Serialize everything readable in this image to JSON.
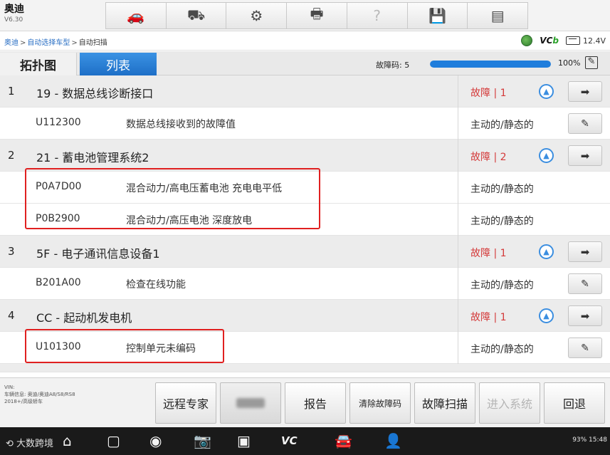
{
  "app": {
    "name": "奥迪",
    "version": "V6.30"
  },
  "toolbar": [
    {
      "icon": "car-upload-icon",
      "glyph": "🚗",
      "state": "active"
    },
    {
      "icon": "car-lift-icon",
      "glyph": "⛟",
      "state": "normal"
    },
    {
      "icon": "gear-icon",
      "glyph": "⚙",
      "state": "normal"
    },
    {
      "icon": "printer-icon",
      "glyph": "🖶",
      "state": "normal"
    },
    {
      "icon": "help-icon",
      "glyph": "?",
      "state": "disabled"
    },
    {
      "icon": "save-icon",
      "glyph": "💾",
      "state": "normal"
    },
    {
      "icon": "message-icon",
      "glyph": "▤",
      "state": "normal"
    }
  ],
  "breadcrumb": {
    "item1": "奥迪",
    "item2": "自动选择车型",
    "item3": "自动扫描",
    "sep": ">"
  },
  "status": {
    "vci": "VC",
    "vci_suffix": "b",
    "voltage": "12.4V"
  },
  "tabs": {
    "topology": "拓扑图",
    "list": "列表"
  },
  "scan": {
    "fault_count_label": "故障码: 5",
    "progress_percent": 100,
    "progress_label": "100%"
  },
  "rows": [
    {
      "type": "sys",
      "index": "1",
      "name": "19 - 数据总线诊断接口",
      "fault": "故障 | 1"
    },
    {
      "type": "dtc",
      "code": "U112300",
      "desc": "数据总线接收到的故障值",
      "state": "主动的/静态的",
      "note": true
    },
    {
      "type": "sys",
      "index": "2",
      "name": "21 - 蓄电池管理系统2",
      "fault": "故障 | 2"
    },
    {
      "type": "dtc",
      "code": "P0A7D00",
      "desc": "混合动力/高电压蓄电池  充电电平低",
      "state": "主动的/静态的",
      "note": false
    },
    {
      "type": "dtc",
      "code": "P0B2900",
      "desc": "混合动力/高压电池  深度放电",
      "state": "主动的/静态的",
      "note": false
    },
    {
      "type": "sys",
      "index": "3",
      "name": "5F - 电子通讯信息设备1",
      "fault": "故障 | 1"
    },
    {
      "type": "dtc",
      "code": "B201A00",
      "desc": "检查在线功能",
      "state": "主动的/静态的",
      "note": true
    },
    {
      "type": "sys",
      "index": "4",
      "name": "CC - 起动机发电机",
      "fault": "故障 | 1"
    },
    {
      "type": "dtc",
      "code": "U101300",
      "desc": "控制单元未编码",
      "state": "主动的/静态的",
      "note": true
    }
  ],
  "vehicle": {
    "vin_label": "VIN:",
    "info": "车辆信息: 奥迪/奥迪A8/S8/RS8",
    "trim": "2018+/高级轿车"
  },
  "actions": [
    {
      "name": "remote-expert-button",
      "label": "远程专家",
      "state": "normal"
    },
    {
      "name": "blurred-button",
      "label": "",
      "state": "blurred"
    },
    {
      "name": "report-button",
      "label": "报告",
      "state": "normal"
    },
    {
      "name": "clear-dtc-button",
      "label": "清除故障码",
      "state": "small"
    },
    {
      "name": "dtc-scan-button",
      "label": "故障扫描",
      "state": "normal"
    },
    {
      "name": "enter-system-button",
      "label": "进入系统",
      "state": "disabled"
    },
    {
      "name": "back-button",
      "label": "回退",
      "state": "normal"
    }
  ],
  "nav": {
    "watermark": "大数跨境",
    "status_text": "93% 15:48",
    "icons": [
      {
        "name": "home-icon",
        "glyph": "⌂"
      },
      {
        "name": "recent-apps-icon",
        "glyph": "▢"
      },
      {
        "name": "browser-icon",
        "glyph": "◉"
      },
      {
        "name": "camera-icon",
        "glyph": "📷"
      },
      {
        "name": "screen-record-icon",
        "glyph": "▣"
      },
      {
        "name": "vci-icon",
        "glyph": "VC"
      },
      {
        "name": "car-icon",
        "glyph": "🚘"
      },
      {
        "name": "user-car-icon",
        "glyph": "👤"
      }
    ]
  },
  "colors": {
    "accent": "#1f7ddc",
    "fault": "#d43a3a",
    "highlight": "#e02020"
  }
}
